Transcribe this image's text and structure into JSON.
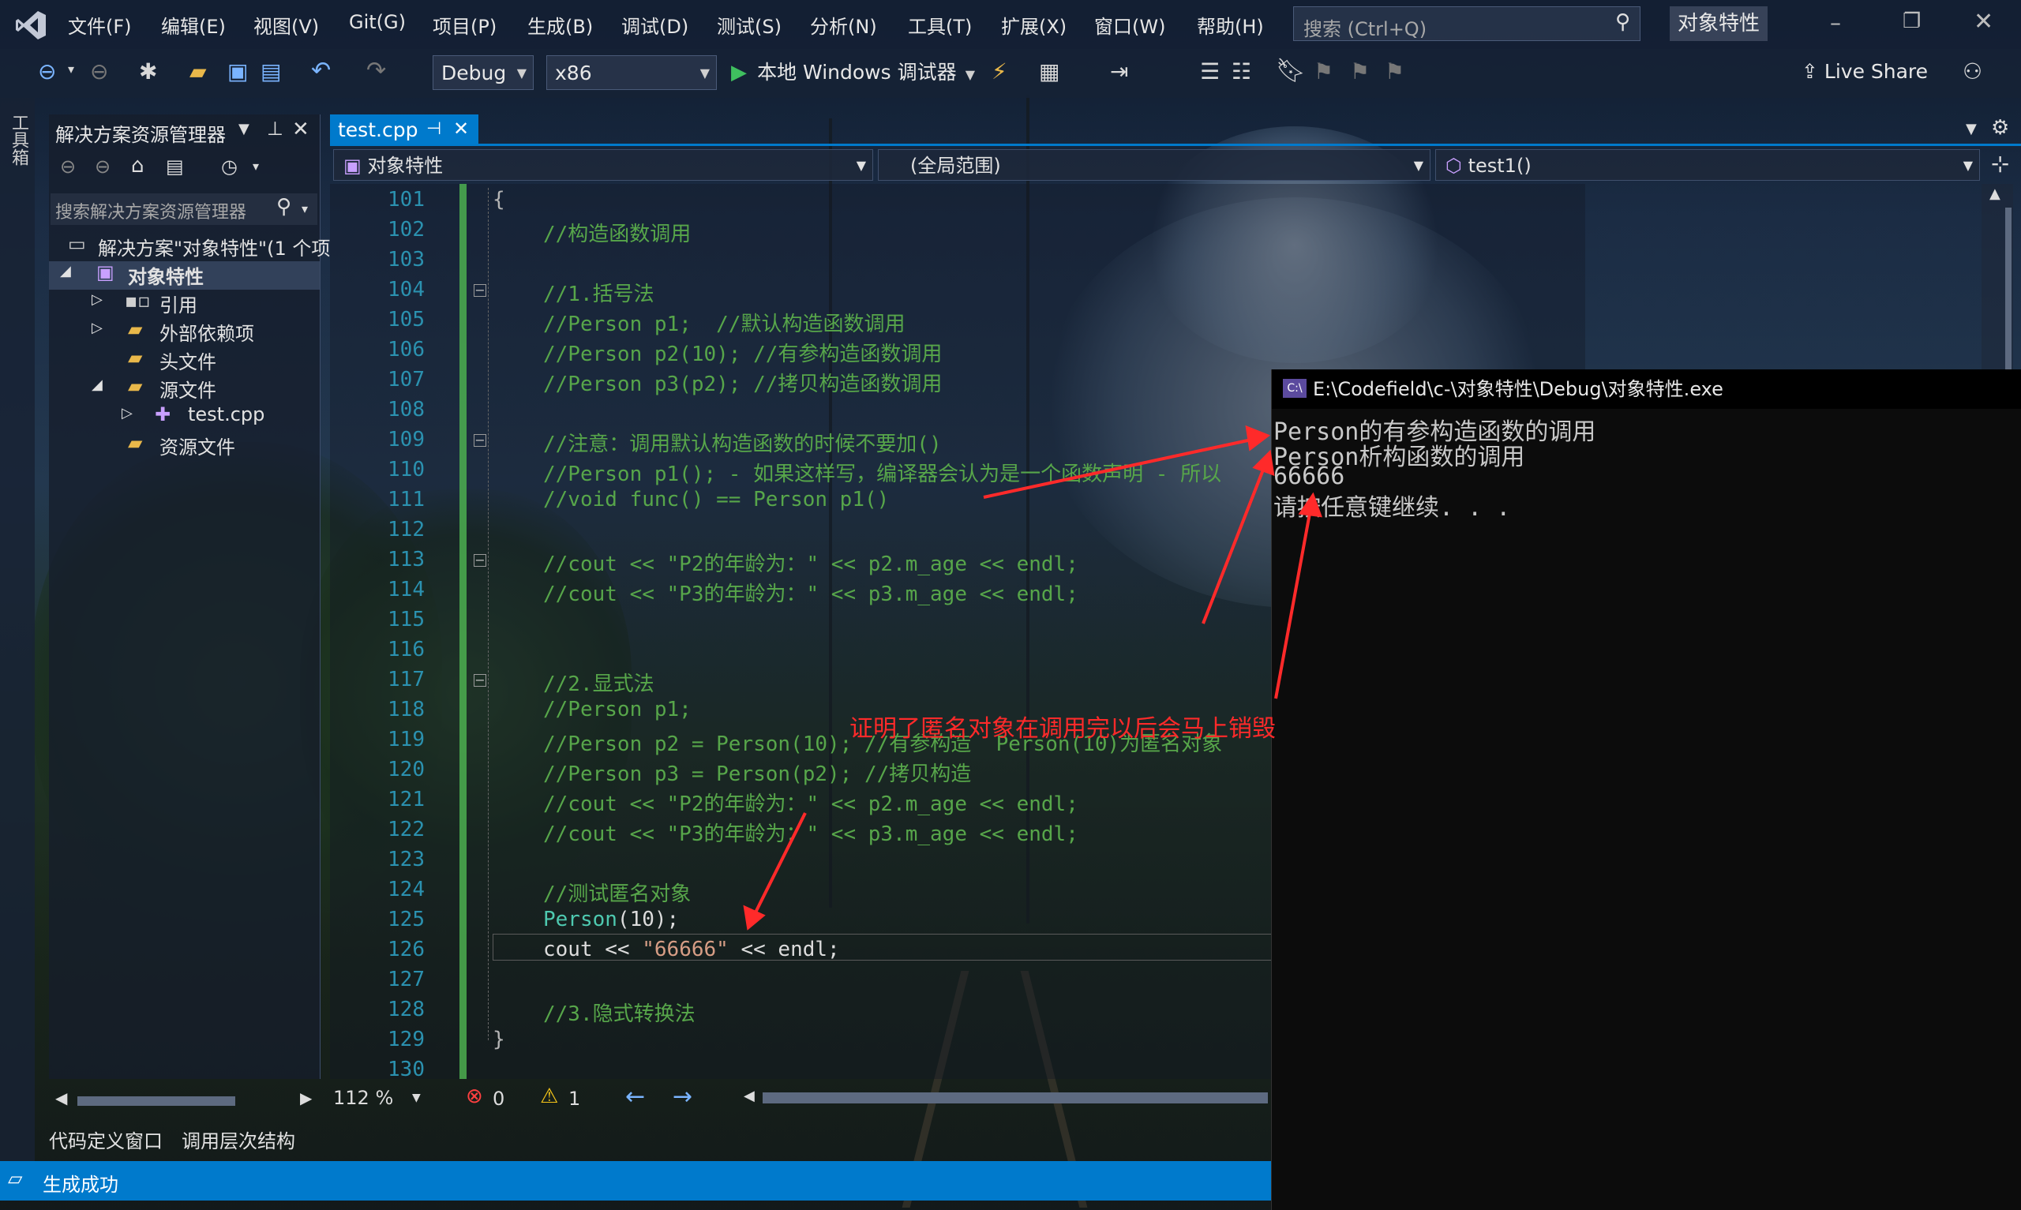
{
  "menu": {
    "items": [
      "文件(F)",
      "编辑(E)",
      "视图(V)",
      "Git(G)",
      "项目(P)",
      "生成(B)",
      "调试(D)",
      "测试(S)",
      "分析(N)",
      "工具(T)",
      "扩展(X)",
      "窗口(W)",
      "帮助(H)"
    ],
    "search_placeholder": "搜索 (Ctrl+Q)",
    "solution_name": "对象特性"
  },
  "toolbar": {
    "config": "Debug",
    "platform": "x86",
    "run_label": "本地 Windows 调试器",
    "live_share": "Live Share"
  },
  "side_strip": {
    "toolbox": "工具箱"
  },
  "solution_explorer": {
    "title": "解决方案资源管理器",
    "search_placeholder": "搜索解决方案资源管理器",
    "nodes": [
      {
        "label": "解决方案\"对象特性\"(1 个项"
      },
      {
        "label": "对象特性"
      },
      {
        "label": "引用"
      },
      {
        "label": "外部依赖项"
      },
      {
        "label": "头文件"
      },
      {
        "label": "源文件"
      },
      {
        "label": "test.cpp"
      },
      {
        "label": "资源文件"
      }
    ]
  },
  "editor": {
    "tab": "test.cpp",
    "nav": {
      "project": "对象特性",
      "scope": "(全局范围)",
      "member": "test1()"
    },
    "lines": [
      {
        "n": "101",
        "parts": [
          {
            "c": "pn",
            "t": "{"
          }
        ],
        "indent": "brace"
      },
      {
        "n": "102",
        "parts": [
          {
            "c": "cm",
            "t": "//构造函数调用"
          }
        ]
      },
      {
        "n": "103",
        "parts": []
      },
      {
        "n": "104",
        "parts": [
          {
            "c": "cm",
            "t": "//1.括号法"
          }
        ]
      },
      {
        "n": "105",
        "parts": [
          {
            "c": "cm",
            "t": "//Person p1;  //默认构造函数调用"
          }
        ]
      },
      {
        "n": "106",
        "parts": [
          {
            "c": "cm",
            "t": "//Person p2(10); //有参构造函数调用"
          }
        ]
      },
      {
        "n": "107",
        "parts": [
          {
            "c": "cm",
            "t": "//Person p3(p2); //拷贝构造函数调用"
          }
        ]
      },
      {
        "n": "108",
        "parts": []
      },
      {
        "n": "109",
        "parts": [
          {
            "c": "cm",
            "t": "//注意：调用默认构造函数的时候不要加()"
          }
        ]
      },
      {
        "n": "110",
        "parts": [
          {
            "c": "cm",
            "t": "//Person p1(); - 如果这样写，编译器会认为是一个函数声明 - 所以"
          }
        ]
      },
      {
        "n": "111",
        "parts": [
          {
            "c": "cm",
            "t": "//void func() == Person p1()"
          }
        ]
      },
      {
        "n": "112",
        "parts": []
      },
      {
        "n": "113",
        "parts": [
          {
            "c": "cm",
            "t": "//cout << \"P2的年龄为：\" << p2.m_age << endl;"
          }
        ]
      },
      {
        "n": "114",
        "parts": [
          {
            "c": "cm",
            "t": "//cout << \"P3的年龄为：\" << p3.m_age << endl;"
          }
        ]
      },
      {
        "n": "115",
        "parts": []
      },
      {
        "n": "116",
        "parts": []
      },
      {
        "n": "117",
        "parts": [
          {
            "c": "cm",
            "t": "//2.显式法"
          }
        ]
      },
      {
        "n": "118",
        "parts": [
          {
            "c": "cm",
            "t": "//Person p1;"
          }
        ]
      },
      {
        "n": "119",
        "parts": [
          {
            "c": "cm",
            "t": "//Person p2 = Person(10); //有参构造  Person(10)为匿名对象"
          }
        ]
      },
      {
        "n": "120",
        "parts": [
          {
            "c": "cm",
            "t": "//Person p3 = Person(p2); //拷贝构造"
          }
        ]
      },
      {
        "n": "121",
        "parts": [
          {
            "c": "cm",
            "t": "//cout << \"P2的年龄为：\" << p2.m_age << endl;"
          }
        ]
      },
      {
        "n": "122",
        "parts": [
          {
            "c": "cm",
            "t": "//cout << \"P3的年龄为：\" << p3.m_age << endl;"
          }
        ]
      },
      {
        "n": "123",
        "parts": []
      },
      {
        "n": "124",
        "parts": [
          {
            "c": "cm",
            "t": "//测试匿名对象"
          }
        ]
      },
      {
        "n": "125",
        "parts": [
          {
            "c": "ty",
            "t": "Person"
          },
          {
            "c": "tx",
            "t": "(10);"
          }
        ]
      },
      {
        "n": "126",
        "parts": [
          {
            "c": "tx",
            "t": "cout << "
          },
          {
            "c": "st",
            "t": "\"66666\""
          },
          {
            "c": "tx",
            "t": " << endl;"
          }
        ]
      },
      {
        "n": "127",
        "parts": []
      },
      {
        "n": "128",
        "parts": [
          {
            "c": "cm",
            "t": "//3.隐式转换法"
          }
        ]
      },
      {
        "n": "129",
        "parts": [
          {
            "c": "pn",
            "t": "}"
          }
        ],
        "indent": "brace"
      },
      {
        "n": "130",
        "parts": []
      }
    ],
    "zoom": "112 %",
    "errors": "0",
    "warnings": "1"
  },
  "annotation": {
    "text": "证明了匿名对象在调用完以后会马上销毁",
    "color": "#ff2a2a"
  },
  "console": {
    "title": "E:\\Codefield\\c-\\对象特性\\Debug\\对象特性.exe",
    "lines": [
      "Person的有参构造函数的调用",
      "Person析构函数的调用",
      "66666",
      "请按任意键继续. . ."
    ]
  },
  "bottom_tabs": [
    "代码定义窗口",
    "调用层次结构"
  ],
  "status": {
    "text": "生成成功"
  },
  "colors": {
    "accent": "#007acc",
    "comment": "#57a64a",
    "line_number": "#2b91af"
  }
}
